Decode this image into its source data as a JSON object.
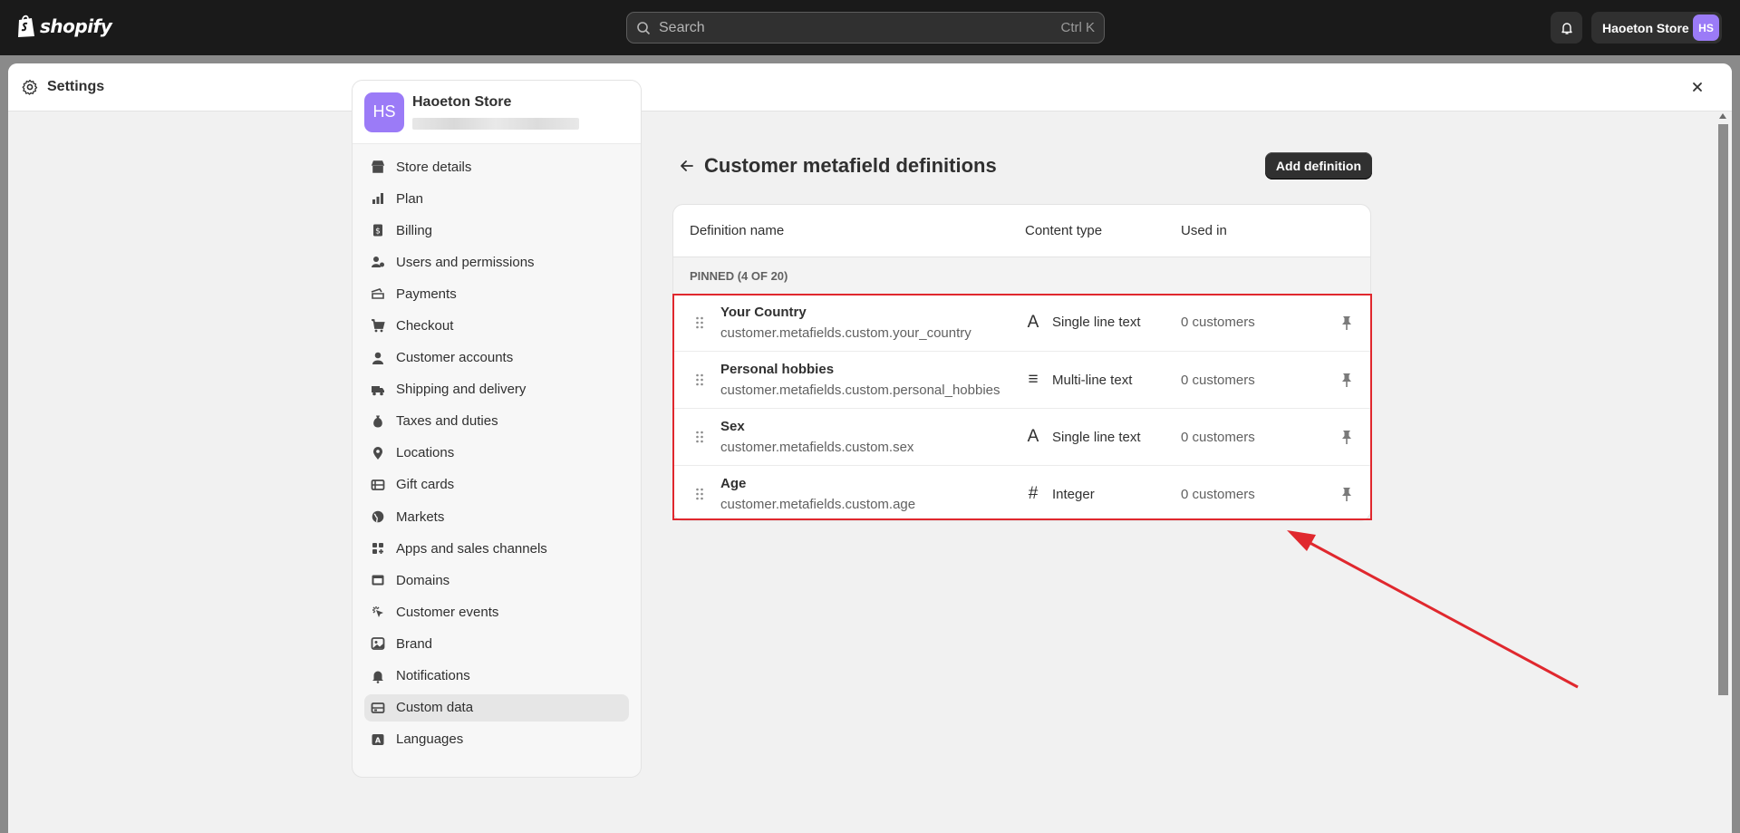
{
  "topbar": {
    "brand": "shopify",
    "search_placeholder": "Search",
    "search_shortcut": "Ctrl K",
    "store_name": "Haoeton Store",
    "store_initials": "HS"
  },
  "modal": {
    "title": "Settings"
  },
  "sidebar": {
    "store_name": "Haoeton Store",
    "store_initials": "HS",
    "items": [
      {
        "label": "Store details",
        "icon": "store-icon"
      },
      {
        "label": "Plan",
        "icon": "plan-icon"
      },
      {
        "label": "Billing",
        "icon": "billing-icon"
      },
      {
        "label": "Users and permissions",
        "icon": "users-icon"
      },
      {
        "label": "Payments",
        "icon": "payments-icon"
      },
      {
        "label": "Checkout",
        "icon": "cart-icon"
      },
      {
        "label": "Customer accounts",
        "icon": "person-icon"
      },
      {
        "label": "Shipping and delivery",
        "icon": "truck-icon"
      },
      {
        "label": "Taxes and duties",
        "icon": "money-bag-icon"
      },
      {
        "label": "Locations",
        "icon": "location-icon"
      },
      {
        "label": "Gift cards",
        "icon": "gift-card-icon"
      },
      {
        "label": "Markets",
        "icon": "globe-icon"
      },
      {
        "label": "Apps and sales channels",
        "icon": "apps-icon"
      },
      {
        "label": "Domains",
        "icon": "domain-icon"
      },
      {
        "label": "Customer events",
        "icon": "cursor-icon"
      },
      {
        "label": "Brand",
        "icon": "brand-icon"
      },
      {
        "label": "Notifications",
        "icon": "bell-icon"
      },
      {
        "label": "Custom data",
        "icon": "custom-data-icon",
        "active": true
      },
      {
        "label": "Languages",
        "icon": "language-icon"
      }
    ]
  },
  "page": {
    "title": "Customer metafield definitions",
    "add_button": "Add definition",
    "columns": {
      "name": "Definition name",
      "type": "Content type",
      "used": "Used in"
    },
    "pinned_label": "PINNED (4 OF 20)",
    "rows": [
      {
        "name": "Your Country",
        "key": "customer.metafields.custom.your_country",
        "type": "Single line text",
        "type_icon": "A",
        "used": "0 customers"
      },
      {
        "name": "Personal hobbies",
        "key": "customer.metafields.custom.personal_hobbies",
        "type": "Multi-line text",
        "type_icon": "≡",
        "used": "0 customers"
      },
      {
        "name": "Sex",
        "key": "customer.metafields.custom.sex",
        "type": "Single line text",
        "type_icon": "A",
        "used": "0 customers"
      },
      {
        "name": "Age",
        "key": "customer.metafields.custom.age",
        "type": "Integer",
        "type_icon": "#",
        "used": "0 customers"
      }
    ]
  },
  "colors": {
    "accent_avatar": "#9b7bf7",
    "highlight": "#e0282e",
    "topbar": "#1a1a1a"
  }
}
